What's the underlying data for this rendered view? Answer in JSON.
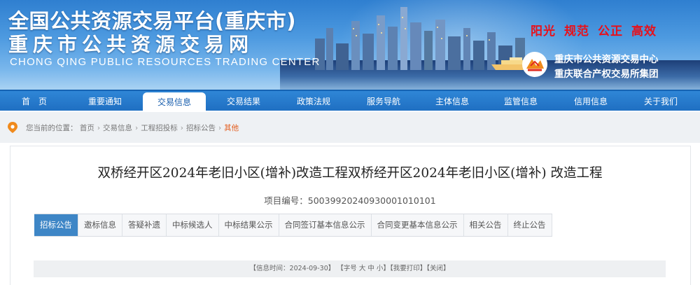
{
  "header": {
    "title_line1": "全国公共资源交易平台(重庆市)",
    "title_line2": "重庆市公共资源交易网",
    "title_en": "CHONG QING PUBLIC RESOURCES TRADING CENTER",
    "slogans": [
      "阳光",
      "规范",
      "公正",
      "高效"
    ],
    "org_line1": "重庆市公共资源交易中心",
    "org_line2": "重庆联合产权交易所集团",
    "slogan_color": "#e8101a"
  },
  "nav": {
    "items": [
      "首　页",
      "重要通知",
      "交易信息",
      "交易结果",
      "政策法规",
      "服务导航",
      "主体信息",
      "监管信息",
      "信用信息",
      "关于我们"
    ],
    "active": "交易信息",
    "color": "#1f6fc2"
  },
  "breadcrumb": {
    "prefix": "您当前的位置：",
    "items": [
      "首页",
      "交易信息",
      "工程招投标",
      "招标公告",
      "其他"
    ]
  },
  "article": {
    "title": "双桥经开区2024年老旧小区(增补)改造工程双桥经开区2024年老旧小区(增补) 改造工程",
    "project_no": "项目编号：500399202409300010101​01"
  },
  "tabs": {
    "items": [
      "招标公告",
      "邀标信息",
      "答疑补遗",
      "中标候选人",
      "中标结果公示",
      "合同签订基本信息公示",
      "合同变更基本信息公示",
      "相关公告",
      "终止公告"
    ],
    "active": "招标公告",
    "active_color": "#3e86c6"
  },
  "infobar": {
    "date_label": "【信息时间：2024-09-30】",
    "font_label": "【字号",
    "font_large": "大",
    "font_medium": "中",
    "font_small": "小】",
    "print_label": "【我要打印】",
    "close_label": "【关闭】"
  }
}
